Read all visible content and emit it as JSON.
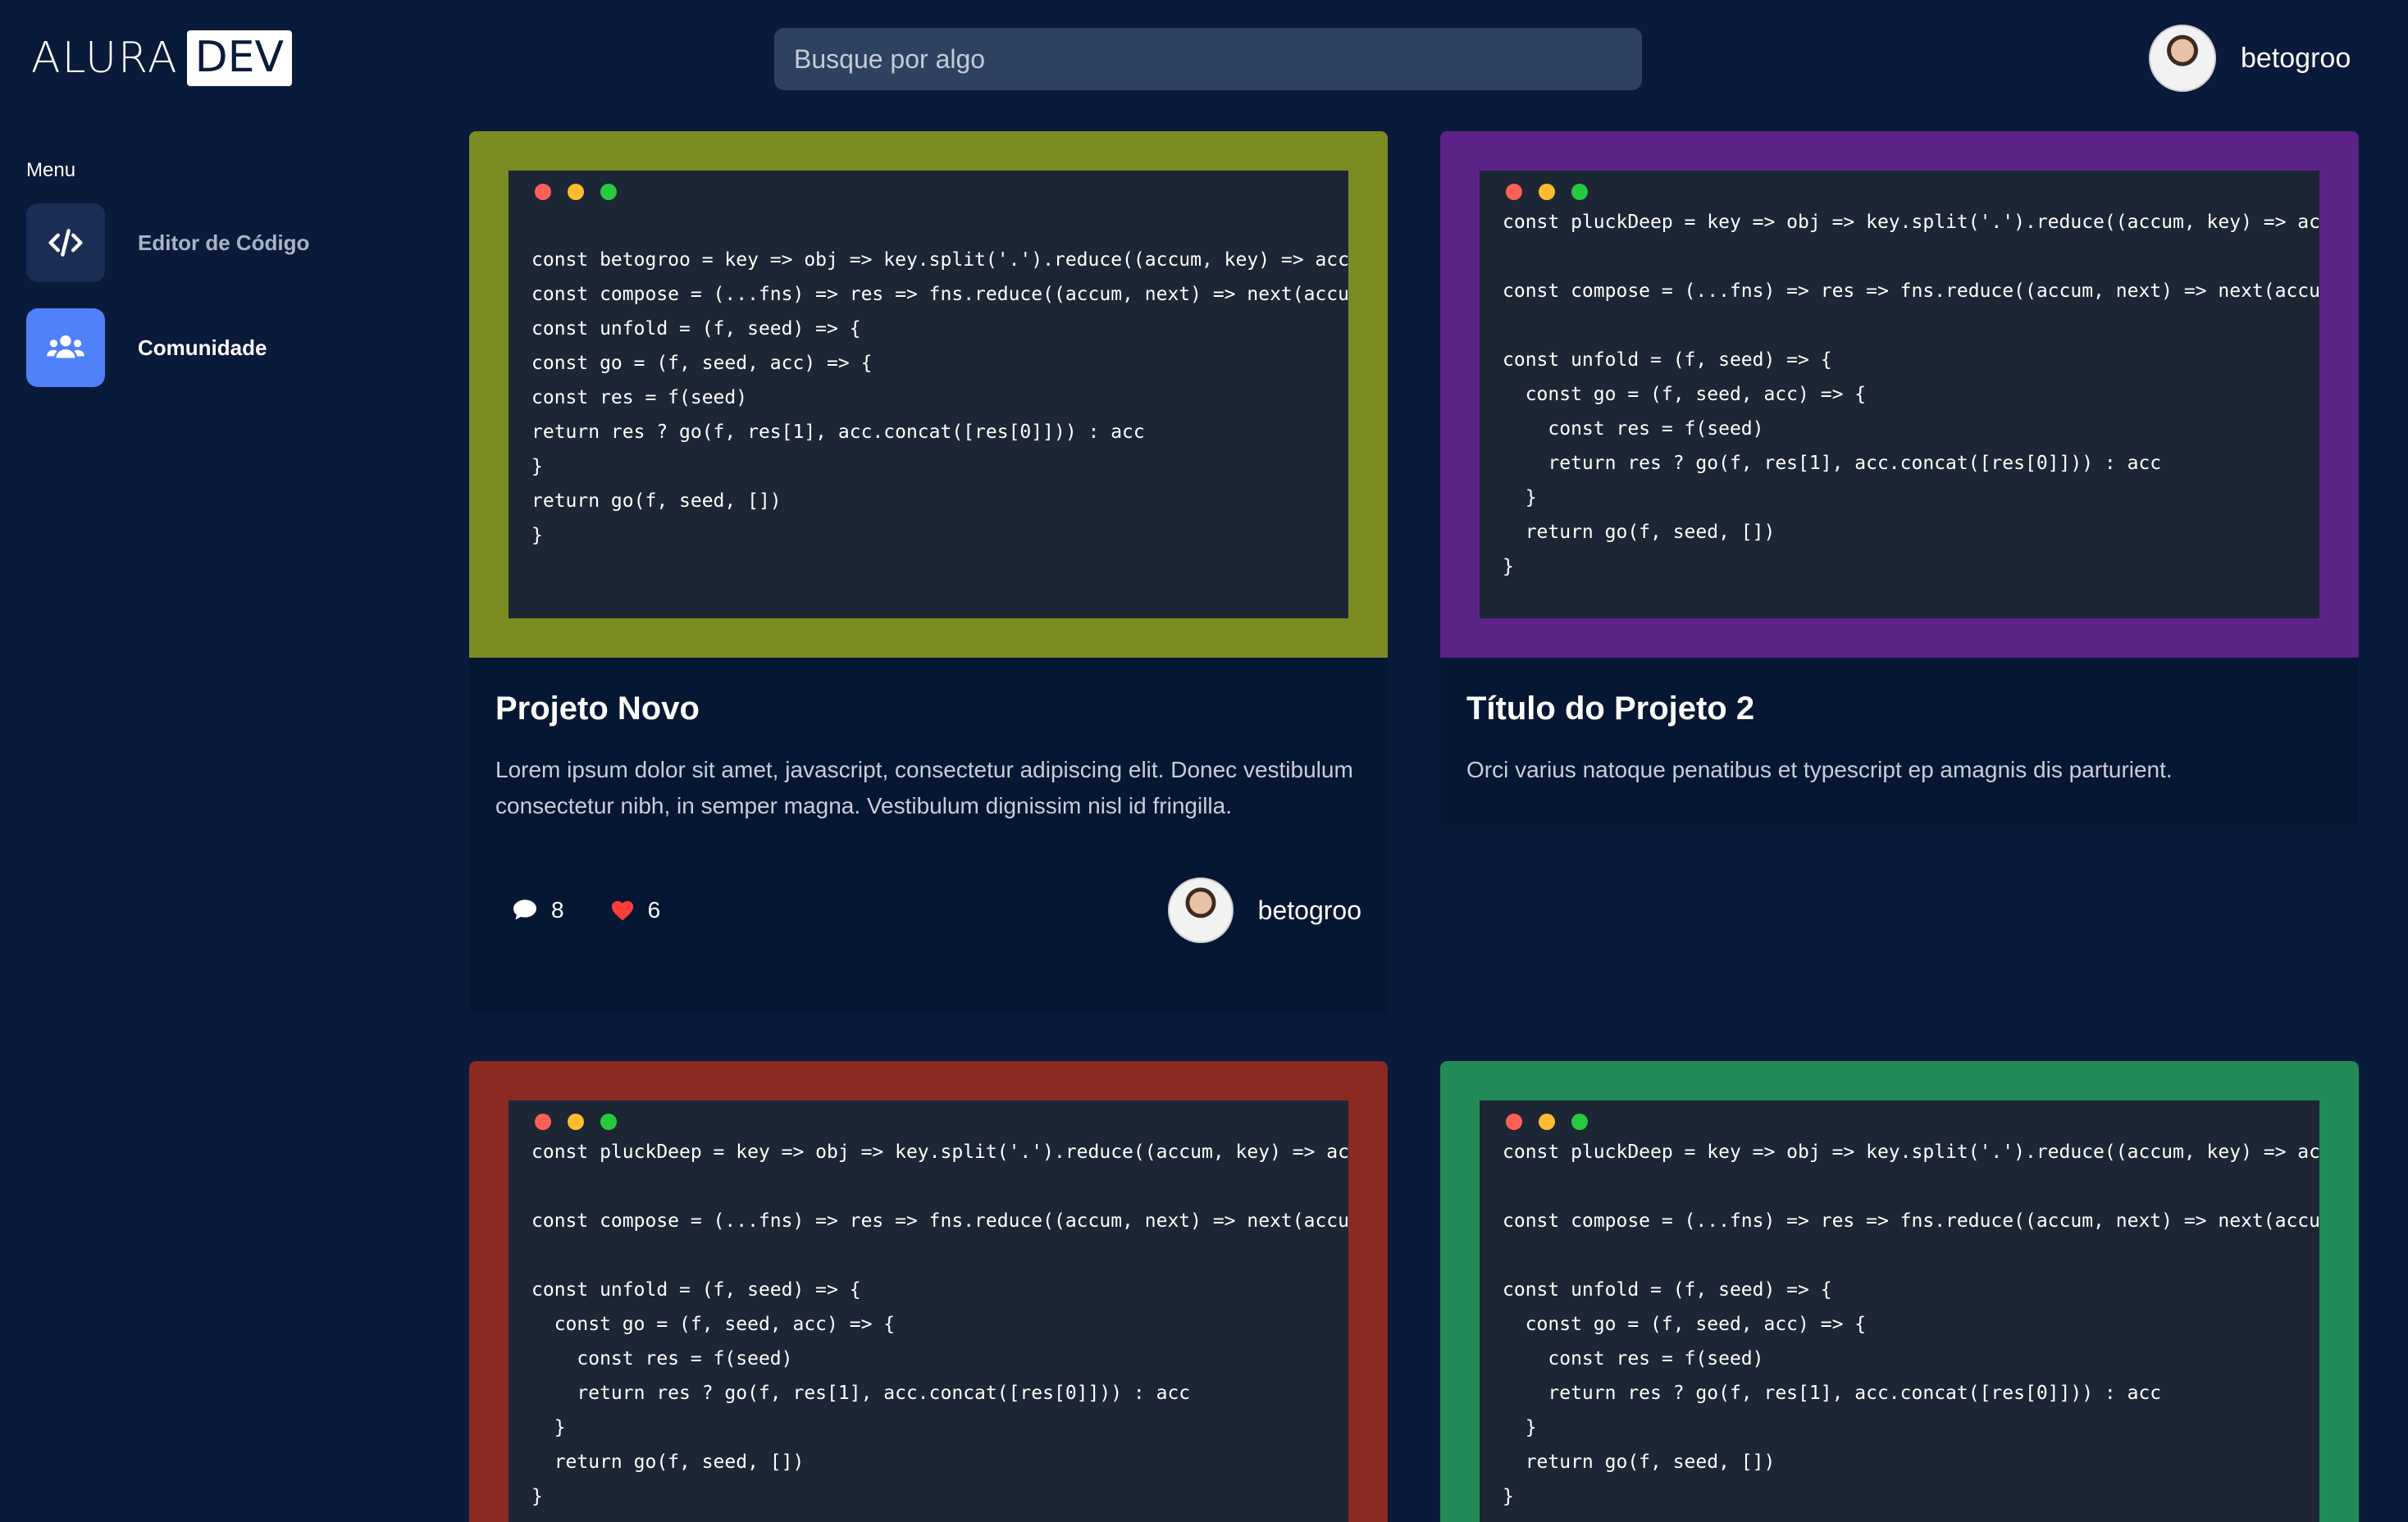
{
  "header": {
    "logo_text": "ALURA",
    "logo_badge": "DEV",
    "search_placeholder": "Busque por algo",
    "username": "betogroo"
  },
  "sidebar": {
    "menu_label": "Menu",
    "items": [
      {
        "label": "Editor de Código",
        "icon": "code-icon",
        "active": false
      },
      {
        "label": "Comunidade",
        "icon": "people-icon",
        "active": true
      }
    ]
  },
  "colors": {
    "background": "#0a1a3a",
    "card1": "#7a8b22",
    "card2": "#5b2287",
    "card3": "#8b2a22",
    "card4": "#218a55",
    "accent": "#5081fb"
  },
  "cards": [
    {
      "title": "Projeto Novo",
      "description": "Lorem ipsum dolor sit amet, javascript, consectetur adipiscing elit. Donec vestibulum consectetur nibh, in semper magna. Vestibulum dignissim nisl id fringilla.",
      "comments": "8",
      "likes": "6",
      "author": "betogroo",
      "code": "\nconst betogroo = key => obj => key.split('.').reduce((accum, key) => accum\nconst compose = (...fns) => res => fns.reduce((accum, next) => next(accum)\nconst unfold = (f, seed) => {\nconst go = (f, seed, acc) => {\nconst res = f(seed)\nreturn res ? go(f, res[1], acc.concat([res[0]])) : acc\n}\nreturn go(f, seed, [])\n}"
    },
    {
      "title": "Título do Projeto 2",
      "description": "Orci varius natoque penatibus et typescript ep amagnis dis parturient.",
      "code": "const pluckDeep = key => obj => key.split('.').reduce((accum, key) => accum\n\nconst compose = (...fns) => res => fns.reduce((accum, next) => next(accum)\n\nconst unfold = (f, seed) => {\n  const go = (f, seed, acc) => {\n    const res = f(seed)\n    return res ? go(f, res[1], acc.concat([res[0]])) : acc\n  }\n  return go(f, seed, [])\n}"
    },
    {
      "code": "const pluckDeep = key => obj => key.split('.').reduce((accum, key) => accum\n\nconst compose = (...fns) => res => fns.reduce((accum, next) => next(accum)\n\nconst unfold = (f, seed) => {\n  const go = (f, seed, acc) => {\n    const res = f(seed)\n    return res ? go(f, res[1], acc.concat([res[0]])) : acc\n  }\n  return go(f, seed, [])\n}"
    },
    {
      "code": "const pluckDeep = key => obj => key.split('.').reduce((accum, key) => accum\n\nconst compose = (...fns) => res => fns.reduce((accum, next) => next(accum)\n\nconst unfold = (f, seed) => {\n  const go = (f, seed, acc) => {\n    const res = f(seed)\n    return res ? go(f, res[1], acc.concat([res[0]])) : acc\n  }\n  return go(f, seed, [])\n}"
    }
  ]
}
